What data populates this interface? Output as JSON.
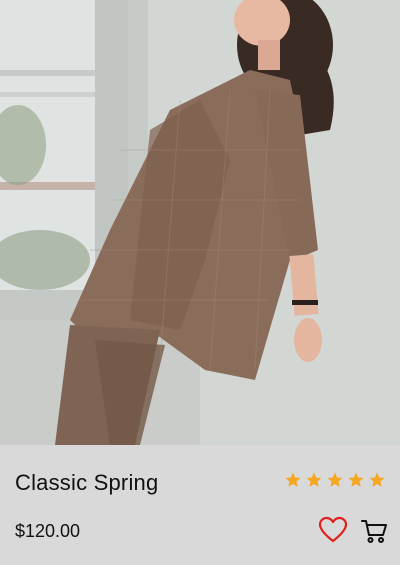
{
  "product": {
    "title": "Classic Spring",
    "price": "$120.00",
    "rating": 5,
    "rating_max": 5
  },
  "icons": {
    "favorite": "heart-icon",
    "cart": "shopping-cart-icon",
    "star": "star-icon"
  },
  "colors": {
    "star": "#f5a623",
    "heart": "#e0201c",
    "cart": "#111111",
    "info_bg": "#d9d9d9"
  }
}
